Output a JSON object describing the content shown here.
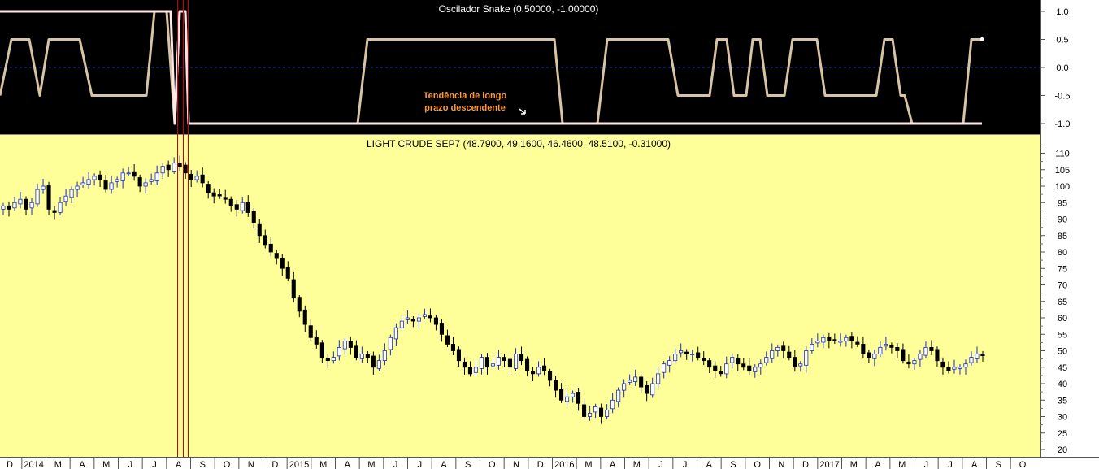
{
  "chart_data": [
    {
      "type": "line",
      "title": "Oscilador Snake (0.50000, -1.00000)",
      "ylim": [
        -1.15,
        1.15
      ],
      "yticks": [
        1.0,
        0.5,
        0.0,
        -0.5,
        -1.0
      ],
      "ytick_labels": [
        "1.0",
        "0.5",
        "0.0",
        "-0.5",
        "-1.0"
      ],
      "zero_line": true,
      "background": "#000000",
      "series": [
        {
          "color": "#d8c4a4",
          "points": [
            [
              0,
              -0.5
            ],
            [
              14,
              0.5
            ],
            [
              36,
              0.5
            ],
            [
              49,
              -0.5
            ],
            [
              60,
              0.5
            ],
            [
              98,
              0.5
            ],
            [
              113,
              -0.5
            ],
            [
              180,
              -0.5
            ],
            [
              190,
              1.0
            ],
            [
              205,
              1.0
            ],
            [
              215,
              -1.0
            ],
            [
              221,
              1.0
            ],
            [
              228,
              1.0
            ],
            [
              232,
              -1.0
            ],
            [
              440,
              -1.0
            ],
            [
              452,
              0.5
            ],
            [
              682,
              0.5
            ],
            [
              692,
              -1.0
            ],
            [
              735,
              -1.0
            ],
            [
              747,
              0.5
            ],
            [
              822,
              0.5
            ],
            [
              834,
              -0.5
            ],
            [
              873,
              -0.5
            ],
            [
              882,
              0.5
            ],
            [
              894,
              0.5
            ],
            [
              903,
              -0.5
            ],
            [
              918,
              -0.5
            ],
            [
              926,
              0.5
            ],
            [
              935,
              0.5
            ],
            [
              944,
              -0.5
            ],
            [
              965,
              -0.5
            ],
            [
              975,
              0.5
            ],
            [
              1005,
              0.5
            ],
            [
              1015,
              -0.5
            ],
            [
              1078,
              -0.5
            ],
            [
              1088,
              0.5
            ],
            [
              1098,
              0.5
            ],
            [
              1108,
              -0.5
            ],
            [
              1113,
              -0.5
            ],
            [
              1122,
              -1.0
            ],
            [
              1185,
              -1.0
            ],
            [
              1195,
              0.5
            ],
            [
              1208,
              0.5
            ]
          ]
        },
        {
          "color": "#ffe8e8",
          "points": [
            [
              0,
              1.0
            ],
            [
              205,
              1.0
            ],
            [
              210,
              1.0
            ],
            [
              215,
              -1.0
            ],
            [
              221,
              1.0
            ],
            [
              228,
              1.0
            ],
            [
              232,
              -1.0
            ],
            [
              1208,
              -1.0
            ]
          ]
        }
      ],
      "annotations": [
        {
          "text": "Tendência de longo",
          "color": "#ff9933"
        },
        {
          "text": "prazo descendente",
          "color": "#ff9933"
        }
      ]
    },
    {
      "type": "candlestick",
      "title": "LIGHT CRUDE SEP7 (48.7900, 49.1600, 46.4600, 48.5100, -0.31000)",
      "ylim": [
        18,
        113
      ],
      "yticks": [
        110,
        105,
        100,
        95,
        90,
        85,
        80,
        75,
        70,
        65,
        60,
        55,
        50,
        45,
        40,
        35,
        30,
        25,
        20
      ],
      "background": "#ffff99",
      "x_tick_labels": [
        "D",
        "2014",
        "M",
        "A",
        "M",
        "J",
        "J",
        "A",
        "S",
        "O",
        "N",
        "D",
        "2015",
        "M",
        "A",
        "M",
        "J",
        "J",
        "A",
        "S",
        "O",
        "N",
        "D",
        "2016",
        "M",
        "A",
        "M",
        "J",
        "J",
        "A",
        "S",
        "O",
        "N",
        "D",
        "2017",
        "M",
        "A",
        "M",
        "J",
        "J",
        "A",
        "S",
        "O"
      ],
      "close_values": [
        94,
        93,
        95,
        96,
        93,
        95,
        99,
        100,
        93,
        92,
        95,
        97,
        99,
        100,
        101,
        102,
        103,
        102,
        99,
        101,
        102,
        104,
        104,
        103,
        100,
        101,
        102,
        104,
        106,
        105,
        107,
        106,
        104,
        102,
        103,
        101,
        98,
        97,
        97,
        96,
        94,
        93,
        95,
        92,
        89,
        85,
        82,
        80,
        78,
        75,
        72,
        66,
        62,
        58,
        54,
        52,
        48,
        47,
        48,
        51,
        53,
        51,
        48,
        49,
        48,
        45,
        47,
        50,
        54,
        57,
        59,
        60,
        59,
        60,
        61,
        60,
        58,
        55,
        52,
        50,
        47,
        45,
        43,
        45,
        48,
        45,
        46,
        48,
        47,
        45,
        49,
        47,
        44,
        43,
        45,
        44,
        41,
        38,
        35,
        36,
        37,
        34,
        30,
        31,
        33,
        30,
        32,
        35,
        38,
        40,
        41,
        42,
        39,
        37,
        40,
        43,
        46,
        47,
        49,
        50,
        49,
        49,
        48,
        47,
        45,
        44,
        43,
        46,
        48,
        46,
        45,
        44,
        45,
        46,
        48,
        50,
        51,
        50,
        48,
        45,
        46,
        50,
        52,
        53,
        54,
        53,
        53,
        53,
        54,
        53,
        52,
        49,
        48,
        49,
        51,
        52,
        51,
        50,
        47,
        46,
        47,
        49,
        51,
        50,
        47,
        45,
        44,
        45,
        45,
        46,
        48,
        49,
        48.51
      ]
    }
  ]
}
